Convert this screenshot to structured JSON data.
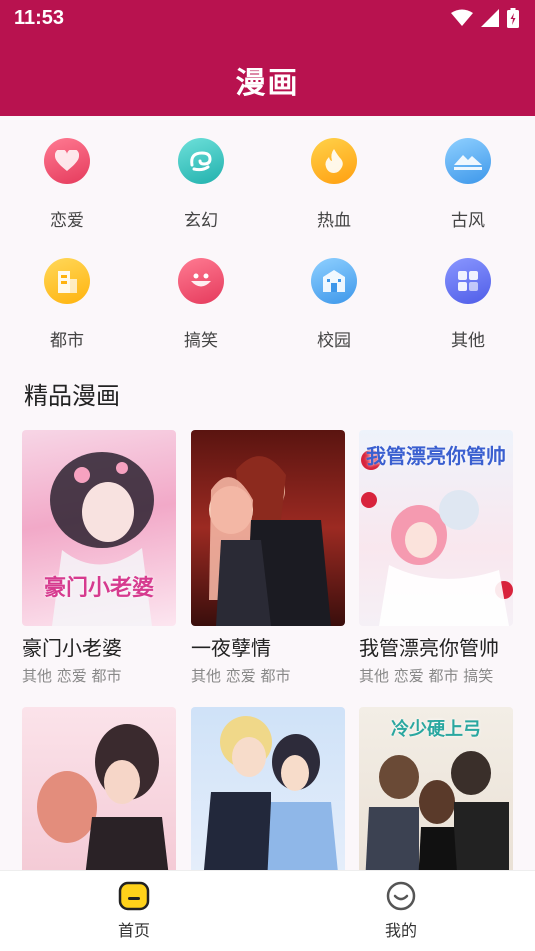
{
  "status": {
    "time": "11:53"
  },
  "app": {
    "title": "漫画"
  },
  "categories": [
    {
      "label": "恋爱",
      "icon": "heart-icon",
      "color": "#f0506e"
    },
    {
      "label": "玄幻",
      "icon": "swirl-icon",
      "color": "#2cc4c0"
    },
    {
      "label": "热血",
      "icon": "flame-icon",
      "color": "#ffb020"
    },
    {
      "label": "古风",
      "icon": "landscape-icon",
      "color": "#4aa8f0"
    },
    {
      "label": "都市",
      "icon": "building-icon",
      "color": "#ffc026"
    },
    {
      "label": "搞笑",
      "icon": "smile-icon",
      "color": "#f0506e"
    },
    {
      "label": "校园",
      "icon": "school-icon",
      "color": "#4aa8f0"
    },
    {
      "label": "其他",
      "icon": "grid-icon",
      "color": "#5b6cf5"
    }
  ],
  "section": {
    "title": "精品漫画"
  },
  "comics": [
    {
      "name": "豪门小老婆",
      "tags": "其他 恋爱 都市",
      "caption": "豪门小老婆"
    },
    {
      "name": "一夜孽情",
      "tags": "其他 恋爱 都市",
      "caption": ""
    },
    {
      "name": "我管漂亮你管帅",
      "tags": "其他 恋爱 都市 搞笑",
      "caption": "我管漂亮你管帅"
    },
    {
      "name": "",
      "tags": "",
      "caption": ""
    },
    {
      "name": "",
      "tags": "",
      "caption": ""
    },
    {
      "name": "",
      "tags": "",
      "caption": "冷少硬上弓"
    }
  ],
  "nav": [
    {
      "label": "首页",
      "icon": "home-icon"
    },
    {
      "label": "我的",
      "icon": "profile-icon"
    }
  ],
  "colors": {
    "brand": "#b8124f"
  }
}
